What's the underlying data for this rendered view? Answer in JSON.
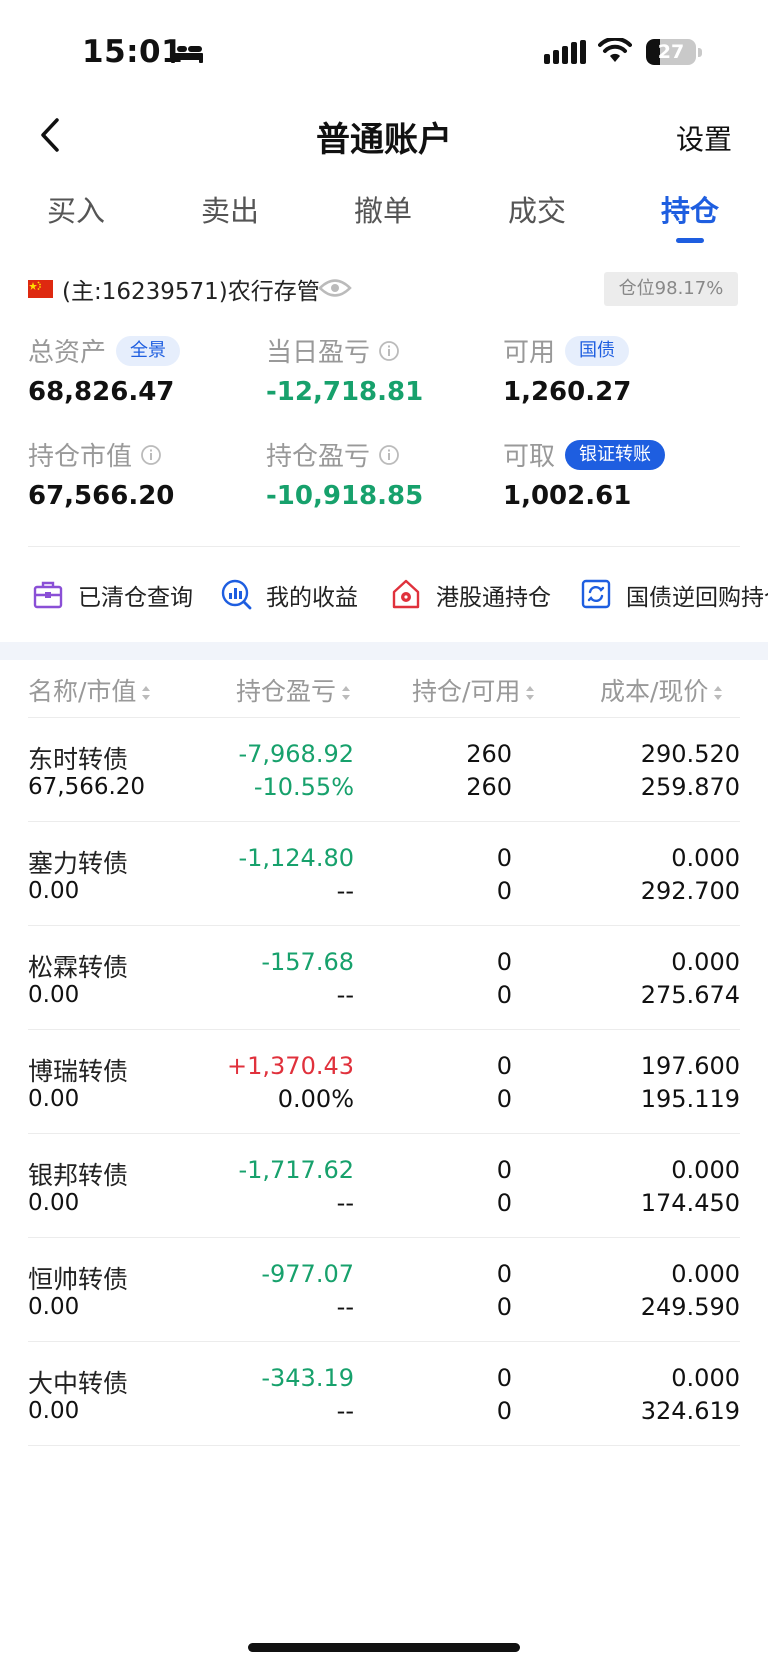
{
  "status_bar": {
    "time": "15:01",
    "battery": "27",
    "battery_level": 0.27
  },
  "nav": {
    "title": "普通账户",
    "settings": "设置"
  },
  "tabs": [
    {
      "label": "买入",
      "active": false
    },
    {
      "label": "卖出",
      "active": false
    },
    {
      "label": "撤单",
      "active": false
    },
    {
      "label": "成交",
      "active": false
    },
    {
      "label": "持仓",
      "active": true
    }
  ],
  "account": {
    "label": "(主:16239571)农行存管",
    "position_ratio": "仓位98.17%"
  },
  "assets": {
    "total": {
      "label": "总资产",
      "pill": "全景",
      "value": "68,826.47"
    },
    "daily_pnl": {
      "label": "当日盈亏",
      "value": "-12,718.81"
    },
    "available": {
      "label": "可用",
      "pill": "国债",
      "value": "1,260.27"
    },
    "holding_value": {
      "label": "持仓市值",
      "value": "67,566.20"
    },
    "holding_pnl": {
      "label": "持仓盈亏",
      "value": "-10,918.85"
    },
    "withdrawable": {
      "label": "可取",
      "pill": "银证转账",
      "value": "1,002.61"
    }
  },
  "shortcuts": [
    "已清仓查询",
    "我的收益",
    "港股通持仓",
    "国债逆回购持仓"
  ],
  "table": {
    "headers": [
      "名称/市值",
      "持仓盈亏",
      "持仓/可用",
      "成本/现价"
    ],
    "rows": [
      {
        "name": "东时转债",
        "market_value": "67,566.20",
        "pnl": "-7,968.92",
        "pnl_pct": "-10.55%",
        "holding": "260",
        "available": "260",
        "cost": "290.520",
        "price": "259.870",
        "trend": "down"
      },
      {
        "name": "塞力转债",
        "market_value": "0.00",
        "pnl": "-1,124.80",
        "pnl_pct": "--",
        "holding": "0",
        "available": "0",
        "cost": "0.000",
        "price": "292.700",
        "trend": "down"
      },
      {
        "name": "松霖转债",
        "market_value": "0.00",
        "pnl": "-157.68",
        "pnl_pct": "--",
        "holding": "0",
        "available": "0",
        "cost": "0.000",
        "price": "275.674",
        "trend": "down"
      },
      {
        "name": "博瑞转债",
        "market_value": "0.00",
        "pnl": "+1,370.43",
        "pnl_pct": "0.00%",
        "holding": "0",
        "available": "0",
        "cost": "197.600",
        "price": "195.119",
        "trend": "up"
      },
      {
        "name": "银邦转债",
        "market_value": "0.00",
        "pnl": "-1,717.62",
        "pnl_pct": "--",
        "holding": "0",
        "available": "0",
        "cost": "0.000",
        "price": "174.450",
        "trend": "down"
      },
      {
        "name": "恒帅转债",
        "market_value": "0.00",
        "pnl": "-977.07",
        "pnl_pct": "--",
        "holding": "0",
        "available": "0",
        "cost": "0.000",
        "price": "249.590",
        "trend": "down"
      },
      {
        "name": "大中转债",
        "market_value": "0.00",
        "pnl": "-343.19",
        "pnl_pct": "--",
        "holding": "0",
        "available": "0",
        "cost": "0.000",
        "price": "324.619",
        "trend": "down"
      }
    ]
  },
  "colors": {
    "accent": "#1e5ee0",
    "loss": "#17a16c",
    "gain": "#e0313c"
  },
  "icons": {
    "back": "chevron-left-icon",
    "eye": "eye-icon",
    "info": "info-icon",
    "cleared": "briefcase-icon",
    "earnings": "chart-search-icon",
    "hk": "bauhinia-home-icon",
    "repo": "refresh-box-icon"
  }
}
